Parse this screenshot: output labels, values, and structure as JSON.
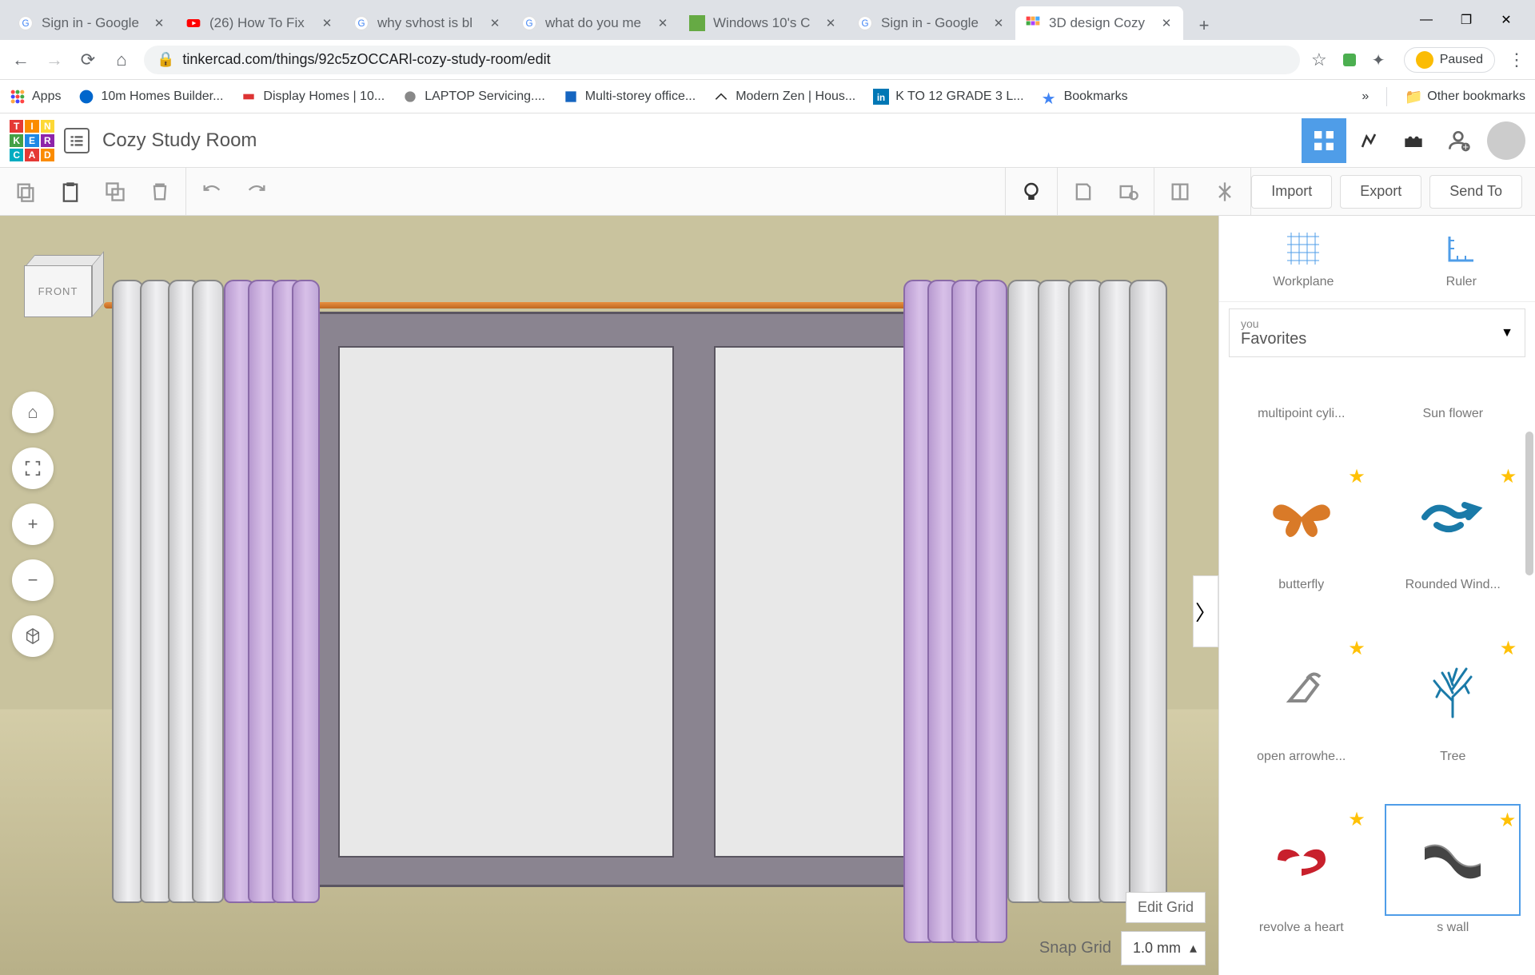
{
  "browser": {
    "tabs": [
      {
        "title": "Sign in - Google",
        "icon": "google"
      },
      {
        "title": "(26) How To Fix",
        "icon": "youtube"
      },
      {
        "title": "why svhost is bl",
        "icon": "google"
      },
      {
        "title": "what do you me",
        "icon": "google"
      },
      {
        "title": "Windows 10's C",
        "icon": "howtogeek"
      },
      {
        "title": "Sign in - Google",
        "icon": "google"
      },
      {
        "title": "3D design Cozy",
        "icon": "tinkercad",
        "active": true
      }
    ],
    "url": "tinkercad.com/things/92c5zOCCARl-cozy-study-room/edit",
    "profile_status": "Paused",
    "bookmarks": [
      {
        "label": "Apps",
        "icon": "apps"
      },
      {
        "label": "10m Homes Builder...",
        "icon": "blue-circle"
      },
      {
        "label": "Display Homes | 10...",
        "icon": "red-box"
      },
      {
        "label": "LAPTOP Servicing....",
        "icon": "laptop"
      },
      {
        "label": "Multi-storey office...",
        "icon": "blue-box"
      },
      {
        "label": "Modern Zen | Hous...",
        "icon": "zen"
      },
      {
        "label": "K TO 12 GRADE 3 L...",
        "icon": "linkedin"
      },
      {
        "label": "Bookmarks",
        "icon": "star"
      }
    ],
    "more_bookmarks": "»",
    "other_bookmarks": "Other bookmarks"
  },
  "app": {
    "project_name": "Cozy Study Room",
    "toolbar": {
      "import": "Import",
      "export": "Export",
      "send_to": "Send To"
    },
    "viewcube_label": "FRONT",
    "edit_grid": "Edit Grid",
    "snap_grid_label": "Snap Grid",
    "snap_grid_value": "1.0 mm"
  },
  "panel": {
    "workplane": "Workplane",
    "ruler": "Ruler",
    "category_small": "you",
    "category_main": "Favorites",
    "shapes": [
      {
        "label": "multipoint cyli...",
        "partial": true
      },
      {
        "label": "Sun flower",
        "partial": true
      },
      {
        "label": "butterfly",
        "color": "#d97a28"
      },
      {
        "label": "Rounded Wind...",
        "color": "#1a7aa8"
      },
      {
        "label": "open arrowhe...",
        "color": "#888"
      },
      {
        "label": "Tree",
        "color": "#1a7aa8"
      },
      {
        "label": "revolve a heart",
        "color": "#c8202c"
      },
      {
        "label": "s wall",
        "color": "#444",
        "selected": true
      }
    ]
  }
}
